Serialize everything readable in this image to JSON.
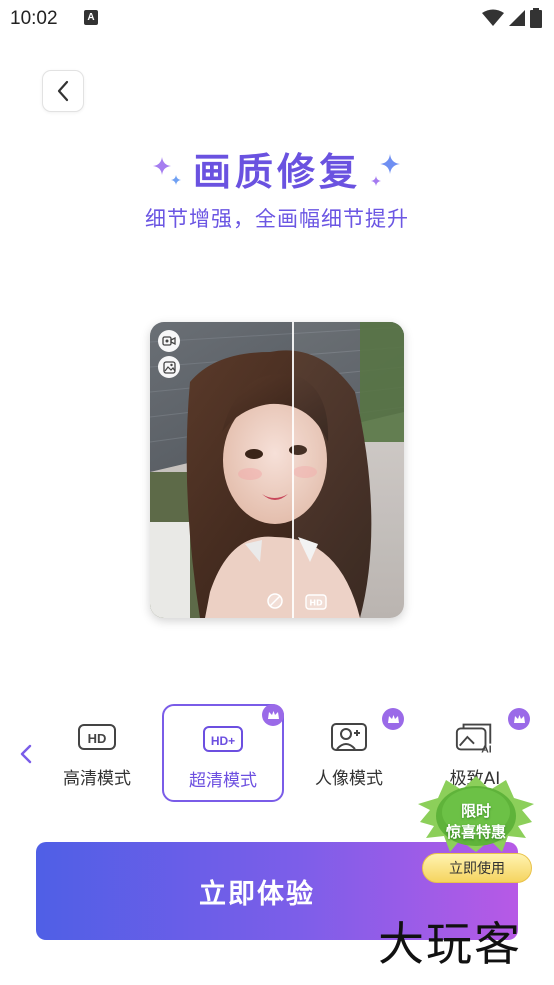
{
  "status_bar": {
    "time": "10:02",
    "notification_icon": "A"
  },
  "header": {
    "back_icon": "chevron-left-icon"
  },
  "hero": {
    "title": "画质修复",
    "subtitle": "细节增强，全画幅细节提升"
  },
  "preview": {
    "top_icons": [
      "video-icon",
      "image-icon"
    ],
    "bottom_icons": [
      "no-icon",
      "hd-icon"
    ]
  },
  "modes": [
    {
      "label": "高清模式",
      "badge": "HD",
      "selected": false,
      "premium": false
    },
    {
      "label": "超清模式",
      "badge": "HD+",
      "selected": true,
      "premium": true
    },
    {
      "label": "人像模式",
      "badge": "portrait",
      "selected": false,
      "premium": true
    },
    {
      "label": "极致AI",
      "badge": "AI",
      "selected": false,
      "premium": true
    }
  ],
  "cta": {
    "label": "立即体验"
  },
  "promo": {
    "line1": "限时",
    "line2": "惊喜特惠",
    "button": "立即使用"
  },
  "watermark": "大玩客",
  "colors": {
    "accent": "#6a52e0",
    "cta_start": "#4f5fe6",
    "cta_end": "#b75ae6",
    "promo_green": "#5fb33a"
  }
}
